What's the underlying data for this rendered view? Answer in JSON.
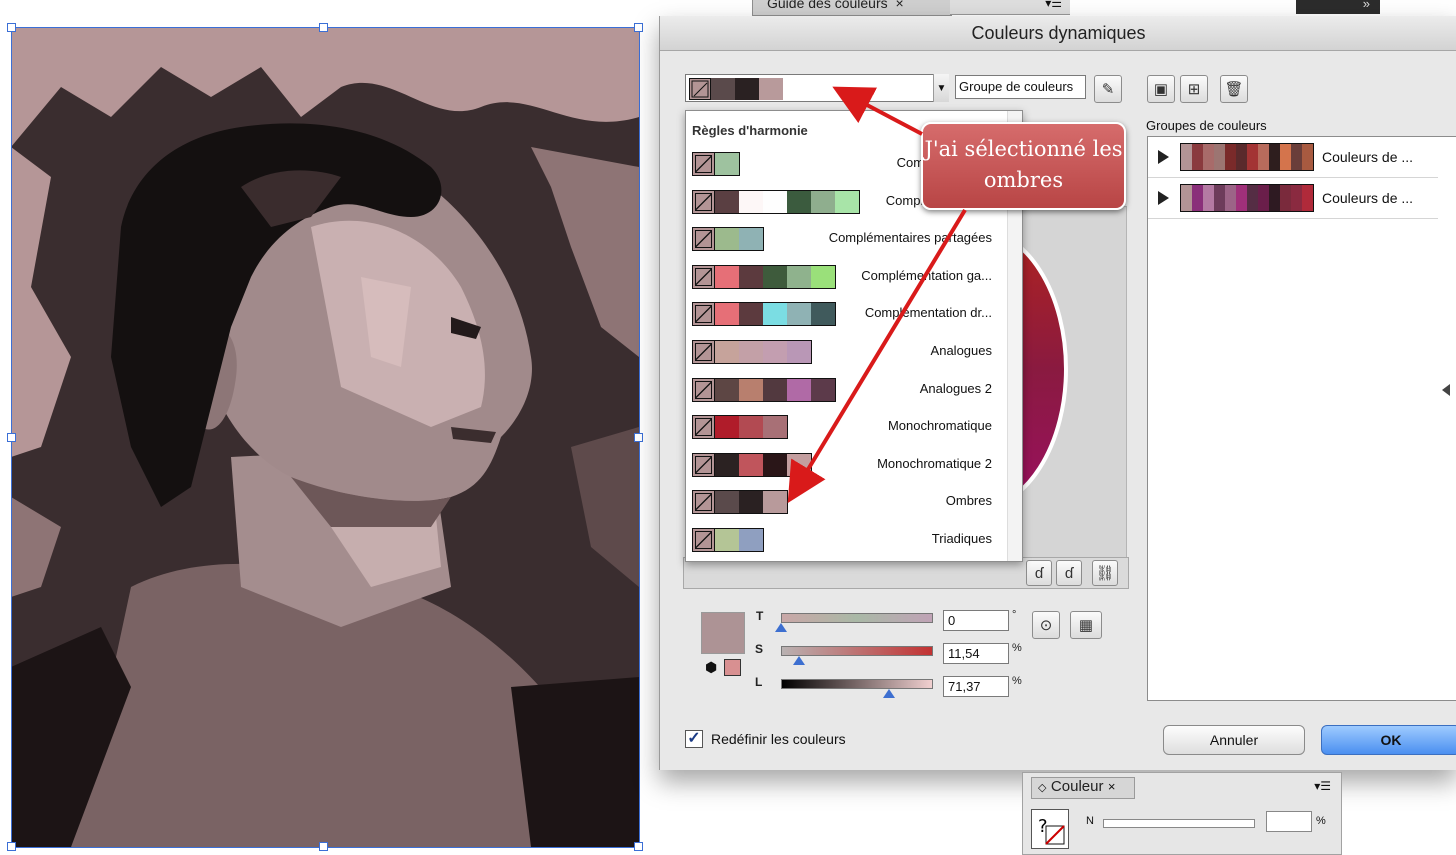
{
  "background_panels": {
    "top_tab_label": "Guide des couleurs",
    "color_panel_tab": "Couleur",
    "color_panel_channel": "N",
    "color_panel_unit": "%"
  },
  "dialog": {
    "title": "Couleurs dynamiques",
    "group_name_value": "Groupe de couleurs",
    "active_swatches": [
      "#b39495",
      "#5a4a4b",
      "#2a2122",
      "#b89a9b"
    ],
    "harmony_rules": {
      "header": "Règles d'harmonie",
      "items": [
        {
          "label": "Complémentaire",
          "colors": [
            "#9ec29f"
          ]
        },
        {
          "label": "Complémentaire 2",
          "colors": [
            "#5a3f42",
            "#fdf7f7",
            "#fefefe",
            "#3b5b3e",
            "#8fae8e",
            "#a8e4a8"
          ]
        },
        {
          "label": "Complémentaires partagées",
          "colors": [
            "#9cba8d",
            "#8fb2b4"
          ]
        },
        {
          "label": "Complémentation ga...",
          "colors": [
            "#e66f77",
            "#5c3a3e",
            "#3e5b3c",
            "#8fb28d",
            "#9ae07a"
          ]
        },
        {
          "label": "Complémentation dr...",
          "colors": [
            "#e66f77",
            "#5c3a3e",
            "#7bdde3",
            "#8fb2b4",
            "#405a5c"
          ]
        },
        {
          "label": "Analogues",
          "colors": [
            "#c6a39b",
            "#c3a0a7",
            "#c39eb0",
            "#b997b6"
          ]
        },
        {
          "label": "Analogues 2",
          "colors": [
            "#5d4644",
            "#b87f6e",
            "#52393f",
            "#b06aa6",
            "#5c3a4a"
          ]
        },
        {
          "label": "Monochromatique",
          "colors": [
            "#b01c2a",
            "#b24a52",
            "#a87076"
          ]
        },
        {
          "label": "Monochromatique 2",
          "colors": [
            "#2b2222",
            "#c0555c",
            "#2a1618",
            "#c39e9f"
          ]
        },
        {
          "label": "Ombres",
          "colors": [
            "#5a4a4b",
            "#2a2122",
            "#b89a9b"
          ]
        },
        {
          "label": "Triadiques",
          "colors": [
            "#b4c596",
            "#8f9fc0"
          ]
        }
      ]
    },
    "callout_text": "J'ai sélectionné les ombres",
    "sliders": [
      {
        "label": "T",
        "value": "0",
        "unit": "°",
        "level": 0.0
      },
      {
        "label": "S",
        "value": "11,54",
        "unit": "%",
        "level": 0.1154
      },
      {
        "label": "L",
        "value": "71,37",
        "unit": "%",
        "level": 0.7137
      }
    ],
    "current_color": "#ad9395",
    "groups_label": "Groupes de couleurs",
    "color_groups": [
      {
        "name": "Couleurs de ...",
        "colors": [
          "#b39495",
          "#8a3a3e",
          "#a86b6a",
          "#9c7572",
          "#7a2a2a",
          "#5a2a2c",
          "#a33434",
          "#b86b5c",
          "#2e1e1e",
          "#d4744c",
          "#6a3e3a",
          "#a85a40"
        ]
      },
      {
        "name": "Couleurs de ...",
        "colors": [
          "#b39495",
          "#8a2f7a",
          "#b47aa3",
          "#6d3c5b",
          "#9c6487",
          "#a0307a",
          "#552d44",
          "#6a1e4a",
          "#2e1a22",
          "#7a2a3c",
          "#8a2a40",
          "#b02a3a"
        ]
      }
    ],
    "recolor_checkbox_label": "Redéfinir les couleurs",
    "cancel_label": "Annuler",
    "ok_label": "OK"
  }
}
